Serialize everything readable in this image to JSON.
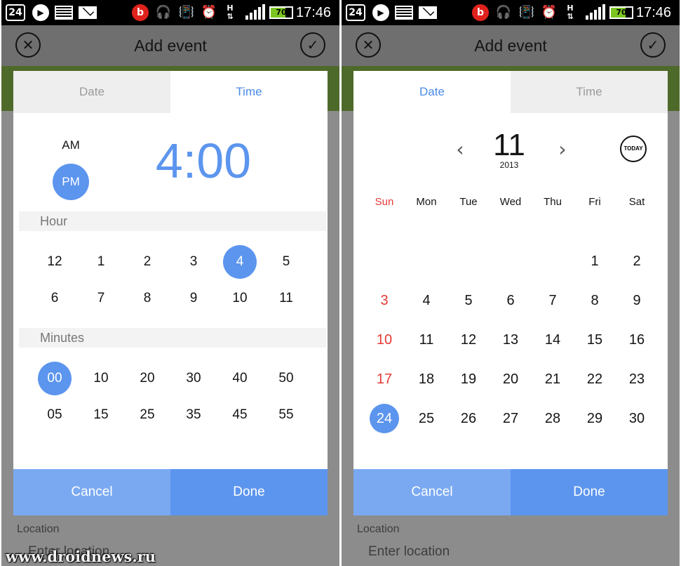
{
  "status_bar": {
    "date_badge": "24",
    "time": "17:46",
    "network_type": "H",
    "battery_level": "70",
    "icons": [
      "calendar-icon",
      "play-icon",
      "image-icon",
      "mail-icon",
      "beats-icon",
      "headphones-icon",
      "vibrate-icon",
      "alarm-icon",
      "data-arrows-icon",
      "signal-icon",
      "battery-icon"
    ]
  },
  "screen": {
    "title": "Add event",
    "location_label": "Location",
    "location_placeholder": "Enter location"
  },
  "left_dialog": {
    "tabs": [
      {
        "label": "Date",
        "active": false
      },
      {
        "label": "Time",
        "active": true
      }
    ],
    "time_display": "4:00",
    "am_label": "AM",
    "pm_label": "PM",
    "selected_period": "PM",
    "hour_label": "Hour",
    "hours": [
      "12",
      "1",
      "2",
      "3",
      "4",
      "5",
      "6",
      "7",
      "8",
      "9",
      "10",
      "11"
    ],
    "selected_hour": "4",
    "minutes_label": "Minutes",
    "minutes": [
      "00",
      "10",
      "20",
      "30",
      "40",
      "50",
      "05",
      "15",
      "25",
      "35",
      "45",
      "55"
    ],
    "selected_minute": "00",
    "cancel_label": "Cancel",
    "done_label": "Done"
  },
  "right_dialog": {
    "tabs": [
      {
        "label": "Date",
        "active": true
      },
      {
        "label": "Time",
        "active": false
      }
    ],
    "month": "11",
    "year": "2013",
    "today_label": "TODAY",
    "weekdays": [
      "Sun",
      "Mon",
      "Tue",
      "Wed",
      "Thu",
      "Fri",
      "Sat"
    ],
    "days": [
      "",
      "",
      "",
      "",
      "",
      "1",
      "2",
      "3",
      "4",
      "5",
      "6",
      "7",
      "8",
      "9",
      "10",
      "11",
      "12",
      "13",
      "14",
      "15",
      "16",
      "17",
      "18",
      "19",
      "20",
      "21",
      "22",
      "23",
      "24",
      "25",
      "26",
      "27",
      "28",
      "29",
      "30"
    ],
    "selected_day": "24",
    "cancel_label": "Cancel",
    "done_label": "Done"
  },
  "watermark": "www.droidnews.ru",
  "colors": {
    "accent": "#5c95ee",
    "cancel_button": "#7aa9f2",
    "sunday": "#e53935",
    "header_bar": "#6f6f6f",
    "green_strip": "#4e6a2a"
  }
}
